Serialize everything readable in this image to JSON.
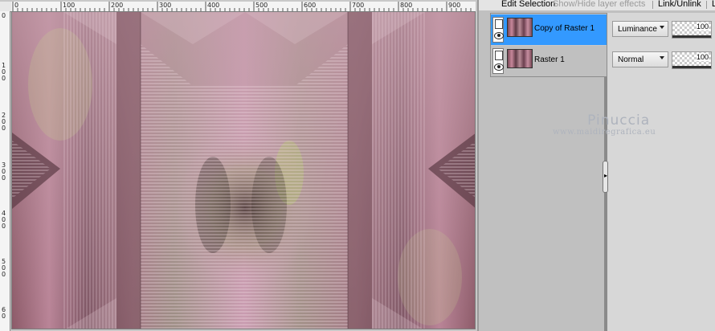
{
  "ruler": {
    "top_ticks": [
      "0",
      "100",
      "200",
      "300",
      "400",
      "500",
      "600",
      "700",
      "800",
      "900"
    ],
    "left_ticks": [
      "0",
      "1 0 0",
      "2 0 0",
      "3 0 0",
      "4 0 0",
      "5 0 0",
      "6 0"
    ]
  },
  "toolbar": {
    "edit_selection": "Edit Selection",
    "show_hide_effects": "Show/Hide layer effects",
    "link_unlink": "Link/Unlink",
    "cut_off": "L"
  },
  "layers": [
    {
      "name": "Copy of Raster 1",
      "selected": true,
      "blend_mode": "Luminance",
      "opacity": "100"
    },
    {
      "name": "Raster 1",
      "selected": false,
      "blend_mode": "Normal",
      "opacity": "100"
    }
  ],
  "watermark": {
    "title": "Pinuccia",
    "url": "www.maidiregrafica.eu"
  },
  "colors": {
    "selection": "#3399ff",
    "panel": "#c0c0c0",
    "strip": "#d7d7d7"
  }
}
